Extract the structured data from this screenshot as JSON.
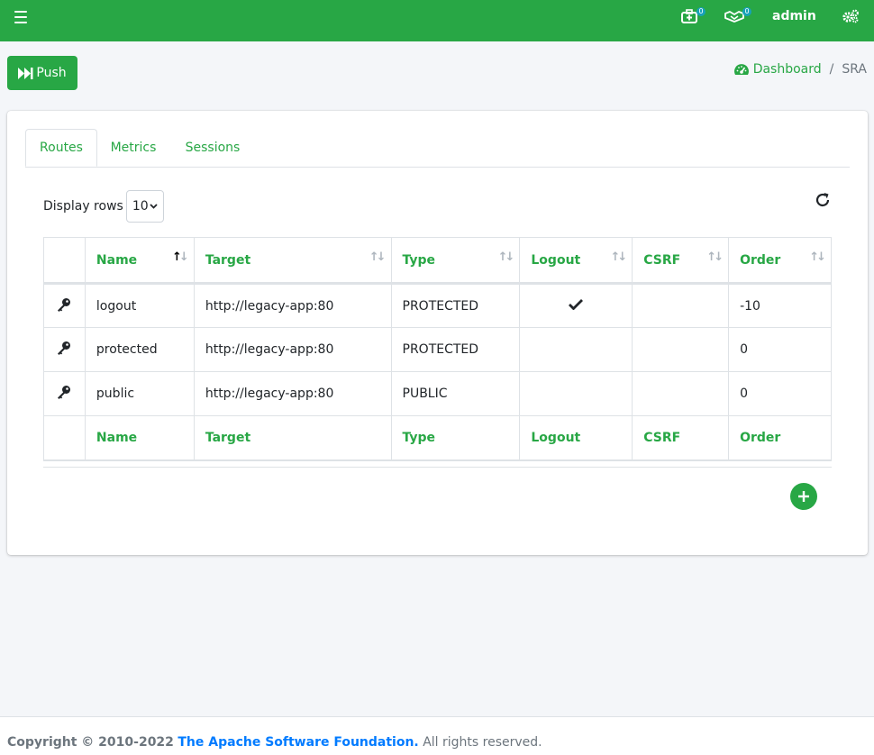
{
  "colors": {
    "brand": "#28a745",
    "badge": "#17a2b8",
    "link": "#007bff"
  },
  "navbar": {
    "menu_icon": "hamburger-icon",
    "notifications_icon": "medkit-icon",
    "notifications_count": "0",
    "tasks_icon": "handshake-icon",
    "tasks_count": "0",
    "user_label": "admin",
    "settings_icon": "cogs-icon"
  },
  "toolbar": {
    "push_label": "Push",
    "push_icon": "fast-forward-icon"
  },
  "breadcrumb": {
    "home_label": "Dashboard",
    "home_icon": "tachometer-icon",
    "separator": "/",
    "current": "SRA"
  },
  "tabs": [
    {
      "label": "Routes",
      "active": true
    },
    {
      "label": "Metrics",
      "active": false
    },
    {
      "label": "Sessions",
      "active": false
    }
  ],
  "table_controls": {
    "display_rows_label": "Display rows",
    "rows_value": "10"
  },
  "table": {
    "columns": [
      "Name",
      "Target",
      "Type",
      "Logout",
      "CSRF",
      "Order"
    ],
    "rows": [
      {
        "name": "logout",
        "target": "http://legacy-app:80",
        "type": "PROTECTED",
        "logout": true,
        "csrf": false,
        "order": "-10"
      },
      {
        "name": "protected",
        "target": "http://legacy-app:80",
        "type": "PROTECTED",
        "logout": false,
        "csrf": false,
        "order": "0"
      },
      {
        "name": "public",
        "target": "http://legacy-app:80",
        "type": "PUBLIC",
        "logout": false,
        "csrf": false,
        "order": "0"
      }
    ]
  },
  "footer": {
    "copyright": "Copyright © 2010-2022",
    "org": "The Apache Software Foundation.",
    "rights": "All rights reserved."
  }
}
